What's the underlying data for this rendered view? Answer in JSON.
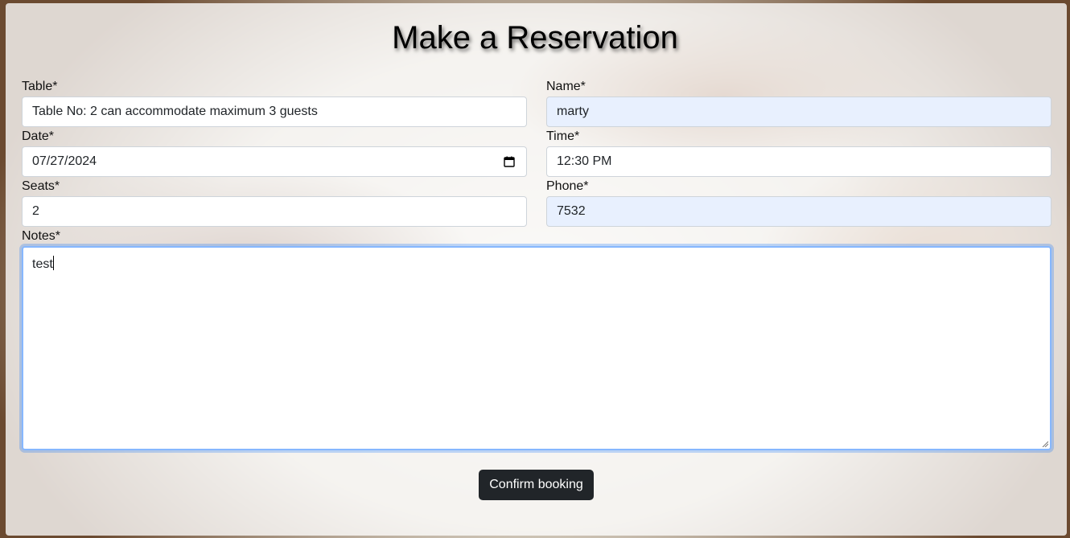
{
  "page": {
    "title": "Make a Reservation"
  },
  "form": {
    "table": {
      "label": "Table*",
      "value": "Table No: 2 can accommodate maximum 3 guests"
    },
    "name": {
      "label": "Name*",
      "value": "marty"
    },
    "date": {
      "label": "Date*",
      "value": "07/27/2024"
    },
    "time": {
      "label": "Time*",
      "value": "12:30 PM"
    },
    "seats": {
      "label": "Seats*",
      "value": "2"
    },
    "phone": {
      "label": "Phone*",
      "value": "7532"
    },
    "notes": {
      "label": "Notes*",
      "value": "test"
    },
    "submit_label": "Confirm booking"
  },
  "icons": {
    "date_picker": "calendar-icon"
  },
  "colors": {
    "button_bg": "#212529",
    "autofill_bg": "#e8f0fe",
    "focus_border": "#86b7fe"
  }
}
